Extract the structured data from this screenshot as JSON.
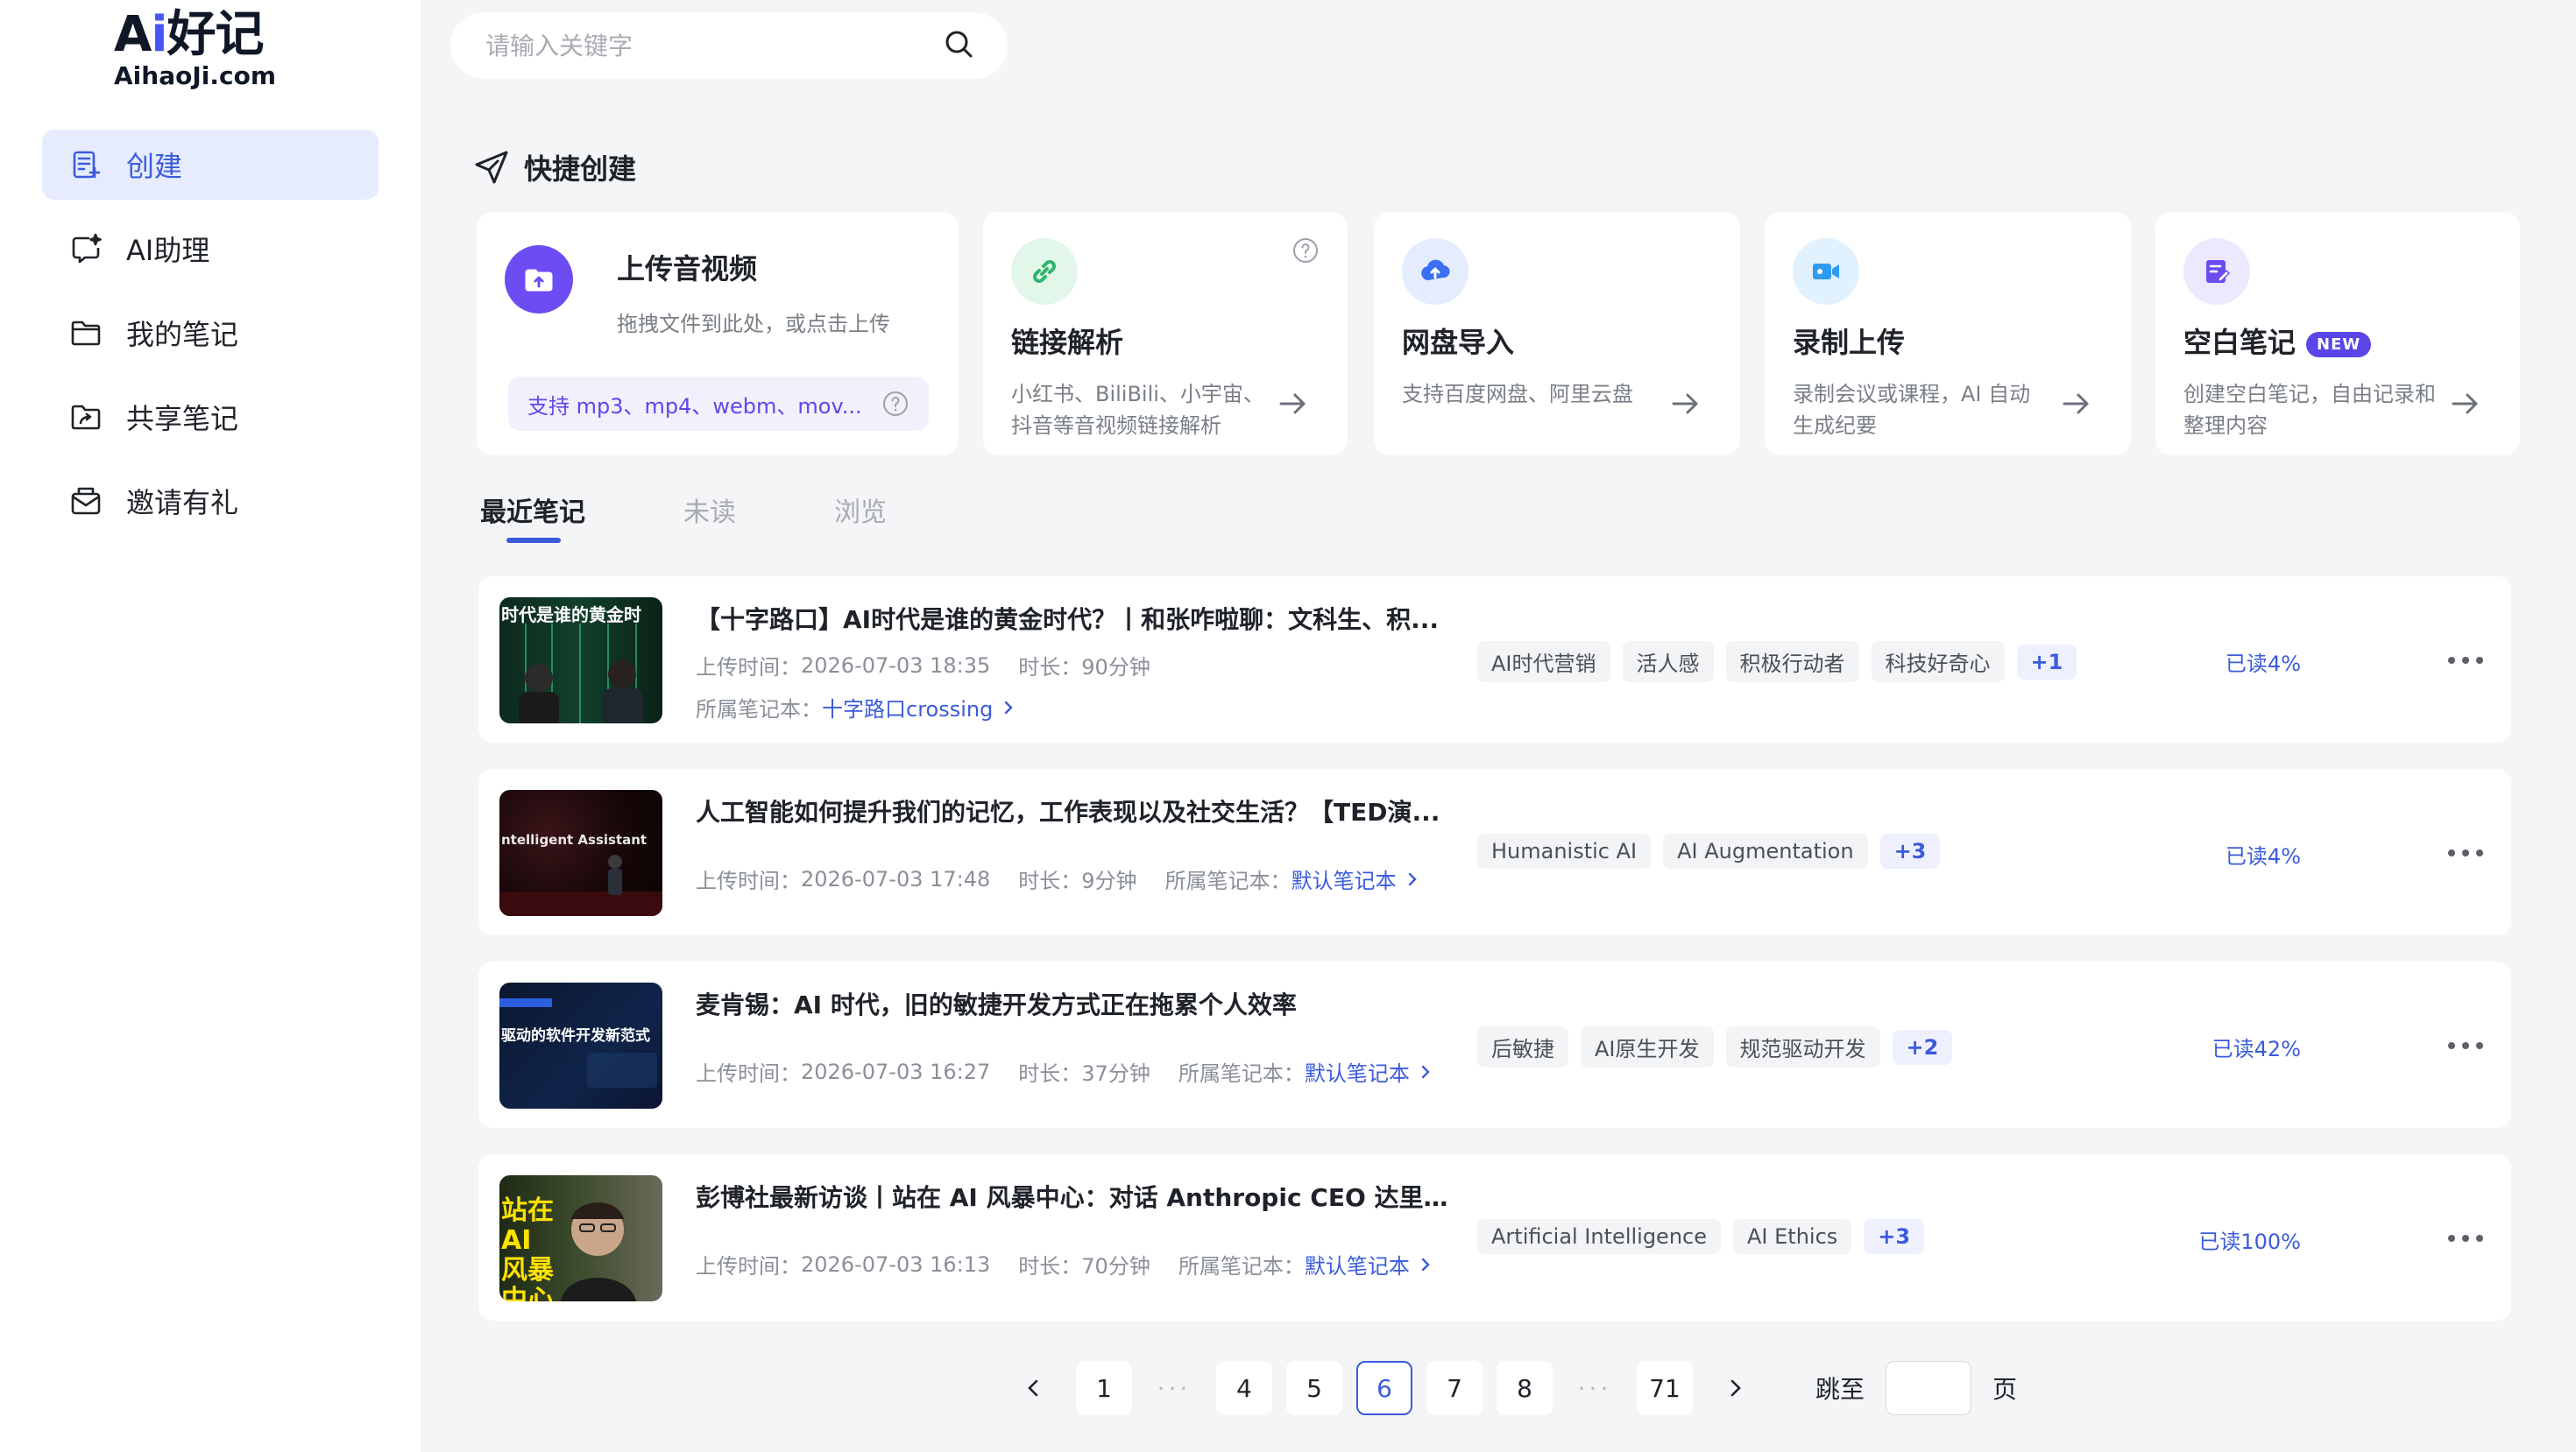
{
  "logo": {
    "brand_prefix": "A",
    "brand_i": "i",
    "brand_cn": "好记",
    "domain": "AihaoJi.com"
  },
  "sidebar": {
    "items": [
      {
        "label": "创建",
        "icon": "create-note-icon",
        "active": true
      },
      {
        "label": "AI助理",
        "icon": "ai-chat-icon",
        "active": false
      },
      {
        "label": "我的笔记",
        "icon": "folder-icon",
        "active": false
      },
      {
        "label": "共享笔记",
        "icon": "shared-folder-icon",
        "active": false
      },
      {
        "label": "邀请有礼",
        "icon": "gift-mail-icon",
        "active": false
      }
    ]
  },
  "search": {
    "placeholder": "请输入关键字",
    "value": ""
  },
  "quick_create": {
    "title": "快捷创建",
    "upload": {
      "title": "上传音视频",
      "desc": "拖拽文件到此处，或点击上传",
      "formats": "支持 mp3、mp4、webm、mov..."
    },
    "cards": [
      {
        "title": "链接解析",
        "desc": "小红书、BiliBili、小宇宙、抖音等音视频链接解析",
        "color": "#2fb46a",
        "icon": "link-icon"
      },
      {
        "title": "网盘导入",
        "desc": "支持百度网盘、阿里云盘",
        "color": "#3b6ef5",
        "icon": "cloud-upload-icon"
      },
      {
        "title": "录制上传",
        "desc": "录制会议或课程，AI 自动生成纪要",
        "color": "#2f9bf0",
        "icon": "video-camera-icon"
      },
      {
        "title": "空白笔记",
        "badge": "NEW",
        "desc": "创建空白笔记，自由记录和整理内容",
        "color": "#6a4cf2",
        "icon": "edit-note-icon"
      }
    ]
  },
  "tabs": [
    {
      "label": "最近笔记",
      "active": true
    },
    {
      "label": "未读",
      "active": false
    },
    {
      "label": "浏览",
      "active": false
    }
  ],
  "notes": [
    {
      "title": "【十字路口】AI时代是谁的黄金时代？丨和张咋啦聊：文科生、积...",
      "upload_label": "上传时间：",
      "upload_time": "2026-07-03 18:35",
      "duration_label": "时长：",
      "duration": "90分钟",
      "notebook_label": "所属笔记本：",
      "notebook": "十字路口crossing",
      "tags": [
        "AI时代营销",
        "活人感",
        "积极行动者",
        "科技好奇心"
      ],
      "more_tags": "+1",
      "progress": "已读4%",
      "thumb_text": "时代是谁的黄金时"
    },
    {
      "title": "人工智能如何提升我们的记忆，工作表现以及社交生活？【TED演...",
      "upload_label": "上传时间：",
      "upload_time": "2026-07-03 17:48",
      "duration_label": "时长：",
      "duration": "9分钟",
      "notebook_label": "所属笔记本：",
      "notebook": "默认笔记本",
      "tags": [
        "Humanistic AI",
        "AI Augmentation"
      ],
      "more_tags": "+3",
      "progress": "已读4%",
      "thumb_text": "ntelligent Assistant"
    },
    {
      "title": "麦肯锡：AI 时代，旧的敏捷开发方式正在拖累个人效率",
      "upload_label": "上传时间：",
      "upload_time": "2026-07-03 16:27",
      "duration_label": "时长：",
      "duration": "37分钟",
      "notebook_label": "所属笔记本：",
      "notebook": "默认笔记本",
      "tags": [
        "后敏捷",
        "AI原生开发",
        "规范驱动开发"
      ],
      "more_tags": "+2",
      "progress": "已读42%",
      "thumb_text": "驱动的软件开发新范式"
    },
    {
      "title": "彭博社最新访谈丨站在 AI 风暴中心：对话 Anthropic CEO 达里奥·...",
      "upload_label": "上传时间：",
      "upload_time": "2026-07-03 16:13",
      "duration_label": "时长：",
      "duration": "70分钟",
      "notebook_label": "所属笔记本：",
      "notebook": "默认笔记本",
      "tags": [
        "Artificial Intelligence",
        "AI Ethics"
      ],
      "more_tags": "+3",
      "progress": "已读100%",
      "thumb_text": "站在 AI风暴中心"
    }
  ],
  "pagination": {
    "pages": [
      "1",
      "4",
      "5",
      "6",
      "7",
      "8",
      "71"
    ],
    "current": "6",
    "ellipsis": "···",
    "jump_label": "跳至",
    "page_suffix": "页",
    "jump_value": ""
  },
  "colors": {
    "accent": "#3b5bdb",
    "sidebar_active_bg": "#e6ebfd",
    "upload_purple": "#6c4cf3"
  }
}
